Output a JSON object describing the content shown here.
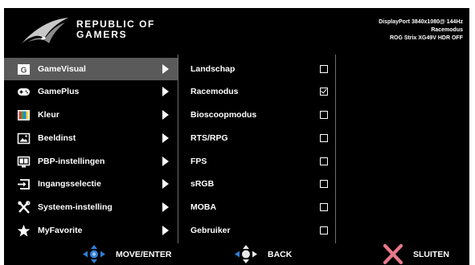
{
  "brand": {
    "line1": "REPUBLIC OF",
    "line2": "GAMERS"
  },
  "status": {
    "line1": "DisplayPort 3840x1080@ 144Hz",
    "line2": "Racemodus",
    "line3": "ROG Strix XG49V HDR OFF"
  },
  "main_menu": [
    {
      "label": "GameVisual",
      "icon": "gamevisual-icon",
      "active": true
    },
    {
      "label": "GamePlus",
      "icon": "gamepad-icon"
    },
    {
      "label": "Kleur",
      "icon": "color-palette-icon"
    },
    {
      "label": "Beeldinst",
      "icon": "image-icon"
    },
    {
      "label": "PBP-instellingen",
      "icon": "pbp-icon"
    },
    {
      "label": "Ingangsselectie",
      "icon": "input-icon"
    },
    {
      "label": "Systeem-instelling",
      "icon": "tools-icon"
    },
    {
      "label": "MyFavorite",
      "icon": "star-icon"
    }
  ],
  "sub_menu": [
    {
      "label": "Landschap",
      "checked": false
    },
    {
      "label": "Racemodus",
      "checked": true
    },
    {
      "label": "Bioscoopmodus",
      "checked": false
    },
    {
      "label": "RTS/RPG",
      "checked": false
    },
    {
      "label": "FPS",
      "checked": false
    },
    {
      "label": "sRGB",
      "checked": false
    },
    {
      "label": "MOBA",
      "checked": false
    },
    {
      "label": "Gebruiker",
      "checked": false
    }
  ],
  "footer": {
    "move_label": "MOVE/ENTER",
    "back_label": "BACK",
    "exit_label": "SLUITEN"
  },
  "colors": {
    "background": "#000000",
    "active_row": "#5a5a5a",
    "dpad": "#2f7fd6",
    "exit": "#e8788a"
  }
}
